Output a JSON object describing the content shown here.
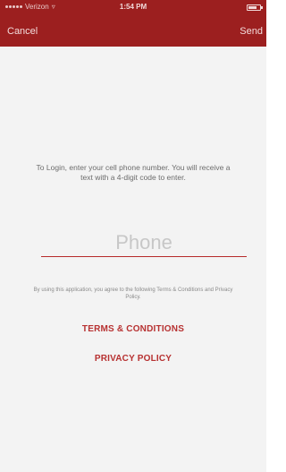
{
  "status_bar": {
    "carrier": "Verizon",
    "time": "1:54 PM"
  },
  "nav": {
    "cancel_label": "Cancel",
    "send_label": "Send"
  },
  "login": {
    "instructions": "To Login, enter your cell phone number. You will receive a text with a 4-digit code to enter.",
    "phone_placeholder": "Phone",
    "phone_value": ""
  },
  "legal": {
    "agreement": "By using this application, you agree to the following Terms & Conditions and Privacy Policy.",
    "terms_label": "TERMS & CONDITIONS",
    "privacy_label": "PRIVACY POLICY"
  },
  "colors": {
    "header_bg": "#9c1f1f",
    "accent": "#b73131",
    "background": "#f3f3f3"
  },
  "icons": [
    "signal-dots-icon",
    "wifi-icon",
    "battery-icon"
  ]
}
